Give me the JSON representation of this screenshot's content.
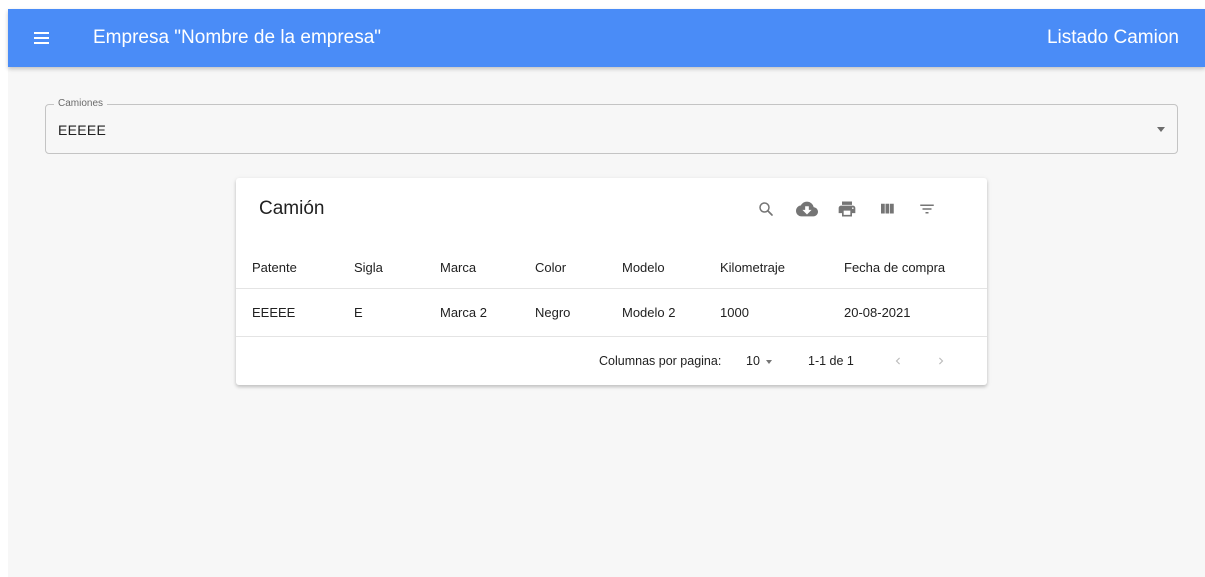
{
  "appbar": {
    "title": "Empresa \"Nombre de la empresa\"",
    "page_heading": "Listado Camion",
    "menu_icon": "menu-icon"
  },
  "select": {
    "label": "Camiones",
    "value": "EEEEE",
    "arrow_icon": "arrow-drop-down-icon"
  },
  "table": {
    "title": "Camión",
    "toolbar_icons": [
      "search-icon",
      "cloud-download-icon",
      "print-icon",
      "view-column-icon",
      "filter-list-icon"
    ],
    "columns": [
      "Patente",
      "Sigla",
      "Marca",
      "Color",
      "Modelo",
      "Kilometraje",
      "Fecha de compra"
    ],
    "rows": [
      [
        "EEEEE",
        "E",
        "Marca 2",
        "Negro",
        "Modelo 2",
        "1000",
        "20-08-2021"
      ]
    ],
    "pagination": {
      "rows_per_page_label": "Columnas por pagina:",
      "rows_per_page": "10",
      "range": "1-1 de 1"
    }
  },
  "colors": {
    "appbar": "#4a8cf7",
    "background": "#f7f7f7",
    "icon": "#757575"
  }
}
